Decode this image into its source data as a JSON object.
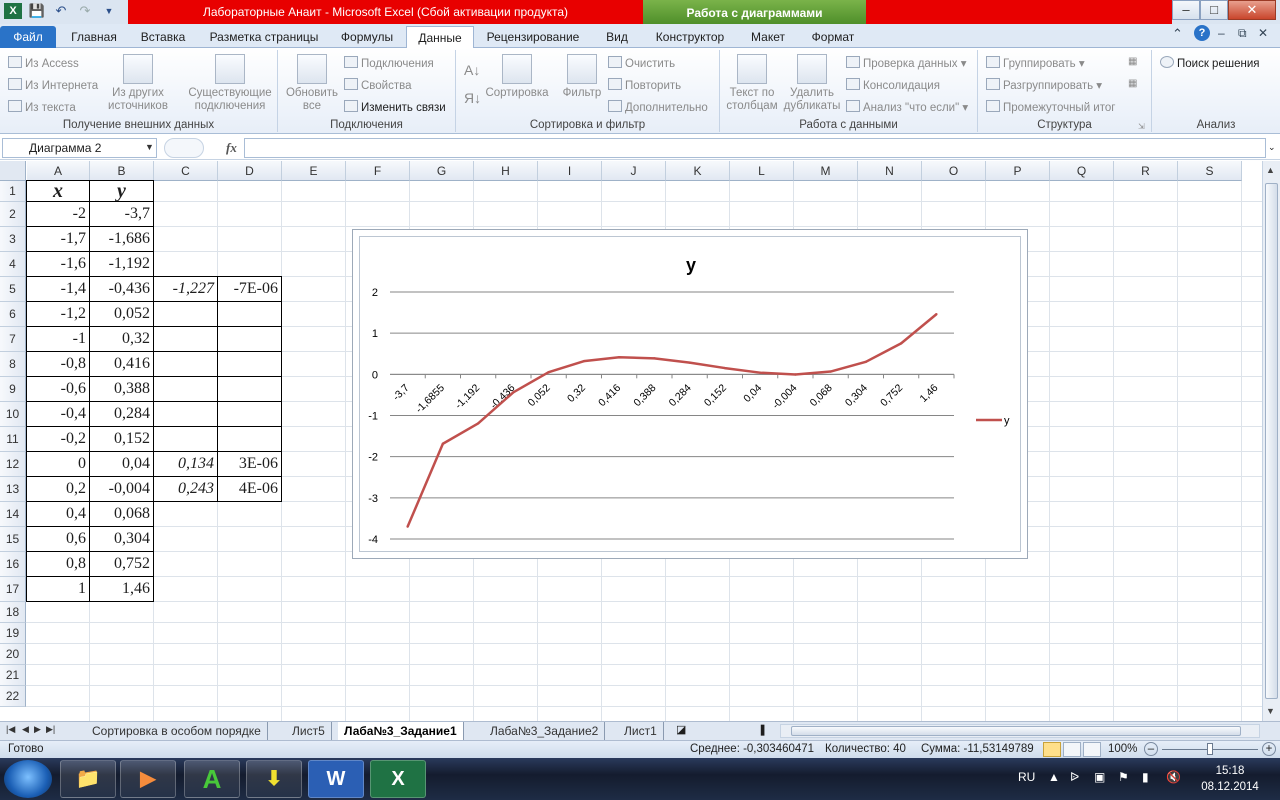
{
  "title_bar": {
    "window_title": "Лабораторные Анаит  -  Microsoft Excel (Сбой активации продукта)",
    "context_tab_group": "Работа с диаграммами"
  },
  "tabs": [
    "Файл",
    "Главная",
    "Вставка",
    "Разметка страницы",
    "Формулы",
    "Данные",
    "Рецензирование",
    "Вид",
    "Конструктор",
    "Макет",
    "Формат"
  ],
  "active_tab": "Данные",
  "ribbon": {
    "get_external": {
      "label": "Получение внешних данных",
      "from_access": "Из Access",
      "from_web": "Из Интернета",
      "from_text": "Из текста",
      "from_other_1": "Из других",
      "from_other_2": "источников",
      "existing_1": "Существующие",
      "existing_2": "подключения"
    },
    "connections": {
      "label": "Подключения",
      "refresh_1": "Обновить",
      "refresh_2": "все",
      "connections": "Подключения",
      "properties": "Свойства",
      "edit_links": "Изменить связи"
    },
    "sort_filter": {
      "label": "Сортировка и фильтр",
      "sort": "Сортировка",
      "filter": "Фильтр",
      "clear": "Очистить",
      "reapply": "Повторить",
      "advanced": "Дополнительно"
    },
    "data_tools": {
      "label": "Работа с данными",
      "text_to_cols_1": "Текст по",
      "text_to_cols_2": "столбцам",
      "remove_dup_1": "Удалить",
      "remove_dup_2": "дубликаты",
      "validation": "Проверка данных",
      "consolidate": "Консолидация",
      "whatif": "Анализ \"что если\""
    },
    "outline": {
      "label": "Структура",
      "group": "Группировать",
      "ungroup": "Разгруппировать",
      "subtotal": "Промежуточный итог"
    },
    "analysis": {
      "label": "Анализ",
      "solver": "Поиск решения"
    }
  },
  "formula_bar": {
    "name_box": "Диаграмма 2",
    "fx": "fx",
    "value": ""
  },
  "columns": [
    "A",
    "B",
    "C",
    "D",
    "E",
    "F",
    "G",
    "H",
    "I",
    "J",
    "K",
    "L",
    "M",
    "N",
    "O",
    "P",
    "Q",
    "R",
    "S"
  ],
  "rows": [
    "1",
    "2",
    "3",
    "4",
    "5",
    "6",
    "7",
    "8",
    "9",
    "10",
    "11",
    "12",
    "13",
    "14",
    "15",
    "16",
    "17",
    "18",
    "19",
    "20",
    "21",
    "22"
  ],
  "table": {
    "header_x": "x",
    "header_y": "y",
    "x": [
      "-2",
      "-1,7",
      "-1,6",
      "-1,4",
      "-1,2",
      "-1",
      "-0,8",
      "-0,6",
      "-0,4",
      "-0,2",
      "0",
      "0,2",
      "0,4",
      "0,6",
      "0,8",
      "1"
    ],
    "y": [
      "-3,7",
      "-1,686",
      "-1,192",
      "-0,436",
      "0,052",
      "0,32",
      "0,416",
      "0,388",
      "0,284",
      "0,152",
      "0,04",
      "-0,004",
      "0,068",
      "0,304",
      "0,752",
      "1,46"
    ],
    "c5": "-1,227",
    "d5": "-7E-06",
    "c12": "0,134",
    "d12": "3E-06",
    "c13": "0,243",
    "d13": "4E-06"
  },
  "chart_data": {
    "type": "line",
    "title": "y",
    "categories": [
      "-3,7",
      "-1,6855",
      "-1,192",
      "-0,436",
      "0,052",
      "0,32",
      "0,416",
      "0,388",
      "0,284",
      "0,152",
      "0,04",
      "-0,004",
      "0,068",
      "0,304",
      "0,752",
      "1,46"
    ],
    "series": [
      {
        "name": "y",
        "values": [
          -3.7,
          -1.686,
          -1.192,
          -0.436,
          0.052,
          0.32,
          0.416,
          0.388,
          0.284,
          0.152,
          0.04,
          -0.004,
          0.068,
          0.304,
          0.752,
          1.46
        ],
        "color": "#c0504d"
      }
    ],
    "yticks": [
      "2",
      "1",
      "0",
      "-1",
      "-2",
      "-3",
      "-4"
    ],
    "ylim": [
      -4,
      2
    ],
    "grid": true,
    "legend": "right"
  },
  "sheet_tabs": [
    "Сортировка в особом порядке",
    "Лист5",
    "Лаба№3_Задание1",
    "Лаба№3_Задание2",
    "Лист1"
  ],
  "active_sheet": "Лаба№3_Задание1",
  "status_bar": {
    "ready": "Готово",
    "average": "Среднее: -0,303460471",
    "count": "Количество: 40",
    "sum": "Сумма: -11,53149789",
    "zoom": "100%"
  },
  "taskbar": {
    "lang": "RU",
    "time": "15:18",
    "date": "08.12.2014"
  }
}
